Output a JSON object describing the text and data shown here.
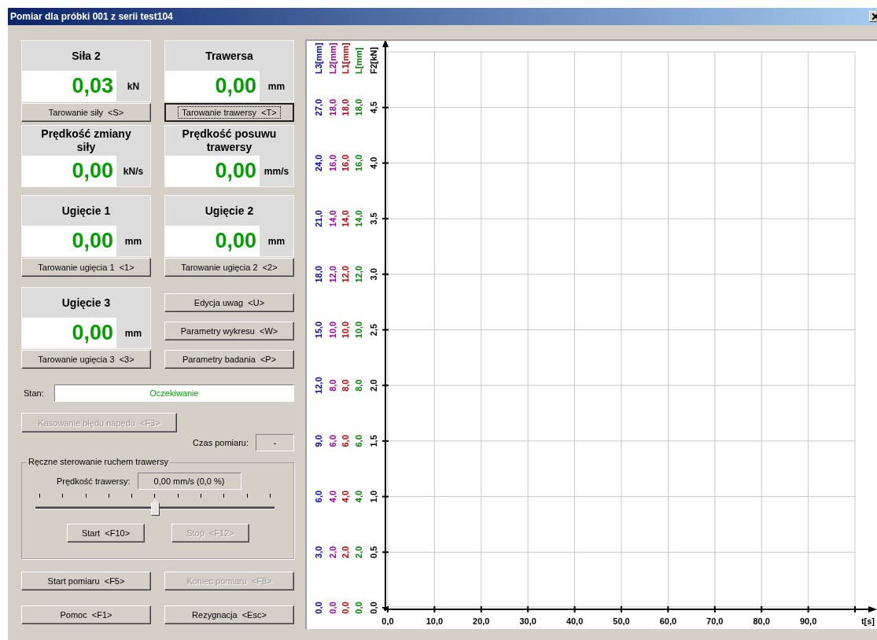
{
  "window": {
    "title": "Pomiar dla próbki 001 z serii test104"
  },
  "readouts": [
    {
      "title": "Siła 2",
      "value": "0,03",
      "unit": "kN",
      "button": {
        "label": "Tarowanie siły  <S>",
        "focused": false
      }
    },
    {
      "title": "Trawersa",
      "value": "0,00",
      "unit": "mm",
      "button": {
        "label": "Tarowanie trawersy  <T>",
        "focused": true
      }
    },
    {
      "title": "Prędkość zmiany siły",
      "value": "0,00",
      "unit": "kN/s"
    },
    {
      "title": "Prędkość posuwu trawersy",
      "value": "0,00",
      "unit": "mm/s"
    },
    {
      "title": "Ugięcie 1",
      "value": "0,00",
      "unit": "mm",
      "button": {
        "label": "Tarowanie ugięcia 1  <1>",
        "focused": false
      }
    },
    {
      "title": "Ugięcie 2",
      "value": "0,00",
      "unit": "mm",
      "button": {
        "label": "Tarowanie ugięcia 2  <2>",
        "focused": false
      }
    },
    {
      "title": "Ugięcie 3",
      "value": "0,00",
      "unit": "mm",
      "button": {
        "label": "Tarowanie ugięcia 3  <3>",
        "focused": false
      }
    }
  ],
  "side_buttons": [
    {
      "label": "Edycja uwag  <U>",
      "disabled": false
    },
    {
      "label": "Parametry wykresu  <W>",
      "disabled": false
    },
    {
      "label": "Parametry badania  <P>",
      "disabled": false
    }
  ],
  "status": {
    "label": "Stan:",
    "value": "Oczekiwanie"
  },
  "drive_reset_button": {
    "label": "Kasowanie błędu napędu  <F3>",
    "disabled": true
  },
  "measurement_time": {
    "label": "Czas pomiaru:",
    "value": "-"
  },
  "manual_control": {
    "title": "Ręczne sterowanie ruchem trawersy",
    "speed_label": "Prędkość trawersy:",
    "speed_value": "0,00 mm/s (0,0 %)",
    "slider": {
      "level": 0.5
    },
    "buttons": [
      {
        "label": "Start  <F10>",
        "disabled": false
      },
      {
        "label": "Stop  <F12>",
        "disabled": true
      }
    ]
  },
  "bottom_buttons": [
    {
      "label": "Start pomiaru  <F5>",
      "disabled": false
    },
    {
      "label": "Koniec pomiaru  <F8>",
      "disabled": true
    },
    {
      "label": "Pomoc  <F1>",
      "disabled": false
    },
    {
      "label": "Rezygnacja  <Esc>",
      "disabled": false
    }
  ],
  "chart": {
    "chart_data": {
      "type": "line",
      "grid": true,
      "xlabel": "t[s]",
      "ylabel": "F2[kN]",
      "xlim": [
        0,
        100
      ],
      "ylim": [
        0,
        5
      ],
      "xticks": [
        {
          "value": 0,
          "label": "0,0"
        },
        {
          "value": 10,
          "label": "10,0"
        },
        {
          "value": 20,
          "label": "20,0"
        },
        {
          "value": 30,
          "label": "30,0"
        },
        {
          "value": 40,
          "label": "40,0"
        },
        {
          "value": 50,
          "label": "50,0"
        },
        {
          "value": 60,
          "label": "60,0"
        },
        {
          "value": 70,
          "label": "70,0"
        },
        {
          "value": 80,
          "label": "80,0"
        },
        {
          "value": 90,
          "label": "90,0"
        }
      ],
      "yticks": [
        {
          "value": 0,
          "label": "0,0"
        },
        {
          "value": 0.5,
          "label": "0,5"
        },
        {
          "value": 1,
          "label": "1,0"
        },
        {
          "value": 1.5,
          "label": "1,5"
        },
        {
          "value": 2,
          "label": "2,0"
        },
        {
          "value": 2.5,
          "label": "2,5"
        },
        {
          "value": 3,
          "label": "3,0"
        },
        {
          "value": 3.5,
          "label": "3,5"
        },
        {
          "value": 4,
          "label": "4,0"
        },
        {
          "value": 4.5,
          "label": "4,5"
        }
      ]
    },
    "secondary_axes": [
      {
        "label": "L[mm]",
        "color": "#008000",
        "ticks": [
          "0,0",
          "2,0",
          "4,0",
          "6,0",
          "8,0",
          "10,0",
          "12,0",
          "14,0",
          "16,0",
          "18,0"
        ]
      },
      {
        "label": "L1[mm]",
        "color": "#c00000",
        "ticks": [
          "0,0",
          "2,0",
          "4,0",
          "6,0",
          "8,0",
          "10,0",
          "12,0",
          "14,0",
          "16,0",
          "18,0"
        ]
      },
      {
        "label": "L2[mm]",
        "color": "#a000a0",
        "ticks": [
          "0,0",
          "2,0",
          "4,0",
          "6,0",
          "8,0",
          "10,0",
          "12,0",
          "14,0",
          "16,0",
          "18,0"
        ]
      },
      {
        "label": "L3[mm]",
        "color": "#0000c0",
        "ticks": [
          "0,0",
          "3,0",
          "6,0",
          "9,0",
          "12,0",
          "15,0",
          "18,0",
          "21,0",
          "24,0",
          "27,0"
        ]
      }
    ]
  }
}
